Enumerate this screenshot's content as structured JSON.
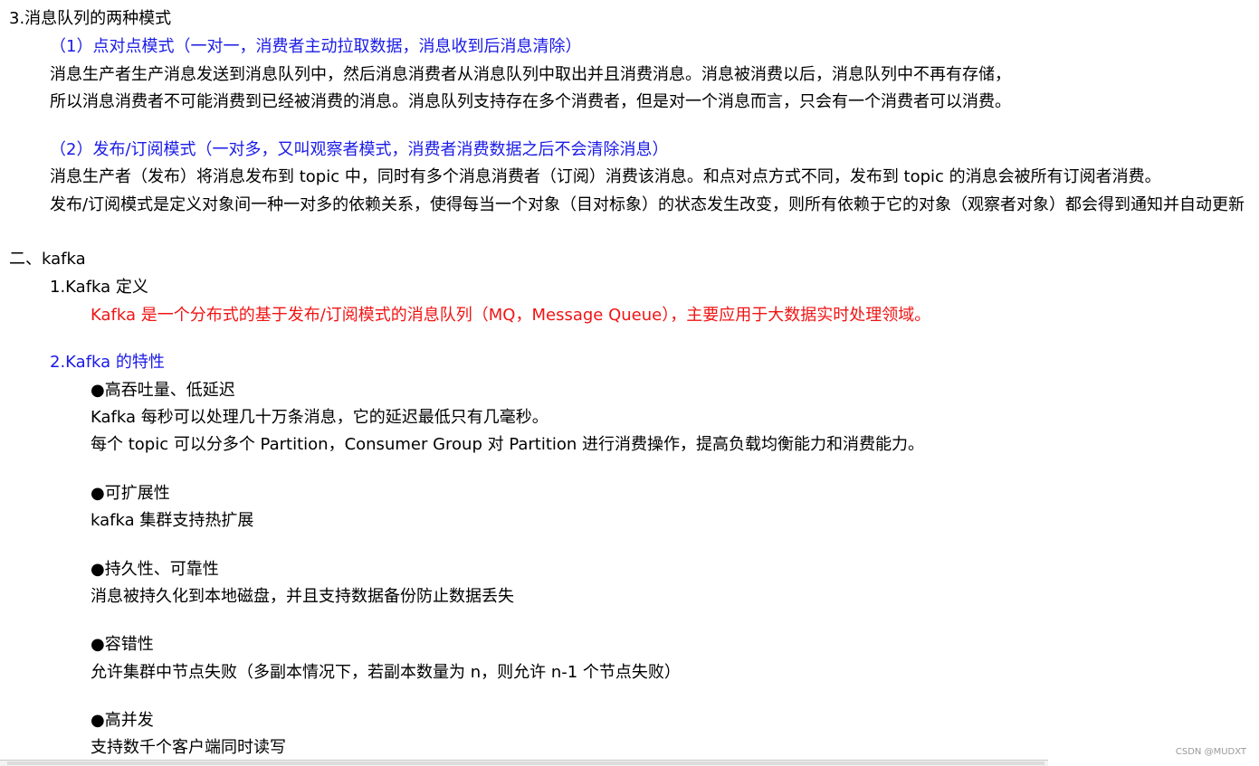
{
  "section3": {
    "title": "3.消息队列的两种模式",
    "mode1": {
      "heading": "（1）点对点模式（一对一，消费者主动拉取数据，消息收到后消息清除）",
      "para1": "消息生产者生产消息发送到消息队列中，然后消息消费者从消息队列中取出并且消费消息。消息被消费以后，消息队列中不再有存储，",
      "para2": "所以消息消费者不可能消费到已经被消费的消息。消息队列支持存在多个消费者，但是对一个消息而言，只会有一个消费者可以消费。"
    },
    "mode2": {
      "heading": "（2）发布/订阅模式（一对多，又叫观察者模式，消费者消费数据之后不会清除消息）",
      "para1": "消息生产者（发布）将消息发布到 topic 中，同时有多个消息消费者（订阅）消费该消息。和点对点方式不同，发布到 topic 的消息会被所有订阅者消费。",
      "para2": "发布/订阅模式是定义对象间一种一对多的依赖关系，使得每当一个对象（目对标象）的状态发生改变，则所有依赖于它的对象（观察者对象）都会得到通知并自动更新"
    }
  },
  "section_kafka": {
    "title": "二、kafka",
    "definition": {
      "heading": "1.Kafka 定义",
      "text": "Kafka 是一个分布式的基于发布/订阅模式的消息队列（MQ，Message Queue），主要应用于大数据实时处理领域。"
    },
    "features": {
      "heading": "2.Kafka 的特性",
      "items": [
        {
          "title": "●高吞吐量、低延迟",
          "lines": [
            "Kafka 每秒可以处理几十万条消息，它的延迟最低只有几毫秒。",
            "每个 topic 可以分多个 Partition，Consumer Group 对 Partition 进行消费操作，提高负载均衡能力和消费能力。"
          ]
        },
        {
          "title": "●可扩展性",
          "lines": [
            "kafka 集群支持热扩展"
          ]
        },
        {
          "title": "●持久性、可靠性",
          "lines": [
            "消息被持久化到本地磁盘，并且支持数据备份防止数据丢失"
          ]
        },
        {
          "title": "●容错性",
          "lines": [
            "允许集群中节点失败（多副本情况下，若副本数量为 n，则允许 n-1 个节点失败）"
          ]
        },
        {
          "title": "●高并发",
          "lines": [
            "支持数千个客户端同时读写"
          ]
        }
      ]
    }
  },
  "watermark": "CSDN @MUDXT",
  "colors": {
    "heading_blue": "#1a1ae6",
    "highlight_red": "#f01414",
    "text": "#000000"
  }
}
